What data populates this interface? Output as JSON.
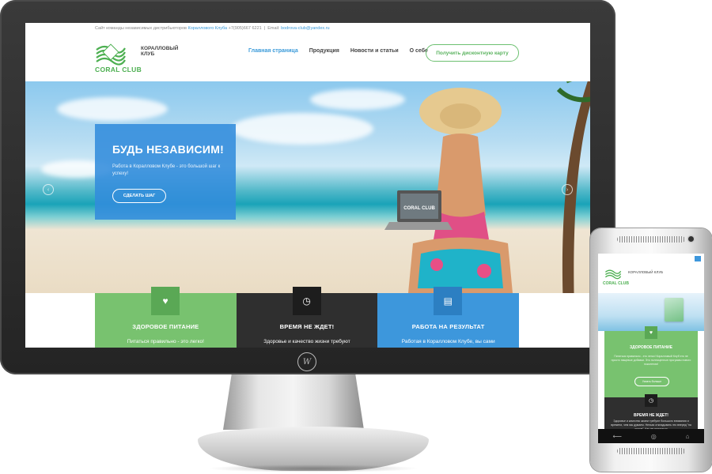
{
  "desktop": {
    "topbar": {
      "text_before": "Сайт команды независимых дистрибьюторов ",
      "company": "Кораллового Клуба",
      "phone": " +7(905)667 6221",
      "email_label": "Email: ",
      "email": "bodrova-club@yandex.ru"
    },
    "logo": {
      "name": "CORAL CLUB",
      "sub_line1": "КОРАЛЛОВЫЙ",
      "sub_line2": "КЛУБ"
    },
    "nav": [
      "Главная страница",
      "Продукция",
      "Новости и статьи",
      "О себе"
    ],
    "cta": "Получить дисконтную карту",
    "hero": {
      "title": "БУДЬ НЕЗАВИСИМ!",
      "text": "Работа в Коралловом Клубе - это большой шаг к успеху!",
      "button": "СДЕЛАТЬ ШАГ",
      "laptop_logo": "CORAL CLUB"
    },
    "features": [
      {
        "title": "ЗДОРОВОЕ ПИТАНИЕ",
        "text": "Питаться правильно - это легко!",
        "icon": "heart-icon"
      },
      {
        "title": "ВРЕМЯ НЕ ЖДЕТ!",
        "text": "Здоровье и качество жизни требуют",
        "icon": "clock-icon"
      },
      {
        "title": "РАБОТА НА РЕЗУЛЬТАТ",
        "text": "Работая в Коралловом Клубе, вы сами",
        "icon": "clipboard-icon"
      }
    ]
  },
  "mobile": {
    "logo": {
      "name": "CORAL CLUB",
      "sub": "КОРАЛЛОВЫЙ КЛУБ"
    },
    "green": {
      "title": "ЗДОРОВОЕ ПИТАНИЕ",
      "text": "Питаться правильно - это легко! Коралловый Клуб это не просто пищевые добавки. Это полноценные програмы нового поколения!",
      "button": "Узнать больше"
    },
    "dark": {
      "title": "ВРЕМЯ НЕ ЖДЕТ!",
      "text": "Здоровье и качество жизни требуют большого внимания и времени, чем мы думаем. Нельзя откладывать это вперед \"на потом\". Как же научиться"
    },
    "nav_icons": [
      "back-icon",
      "home-icon",
      "recent-apps-icon"
    ]
  },
  "colors": {
    "green": "#78c26f",
    "dark": "#2f2f2f",
    "blue": "#3d97dc",
    "link": "#3a9ad9"
  }
}
